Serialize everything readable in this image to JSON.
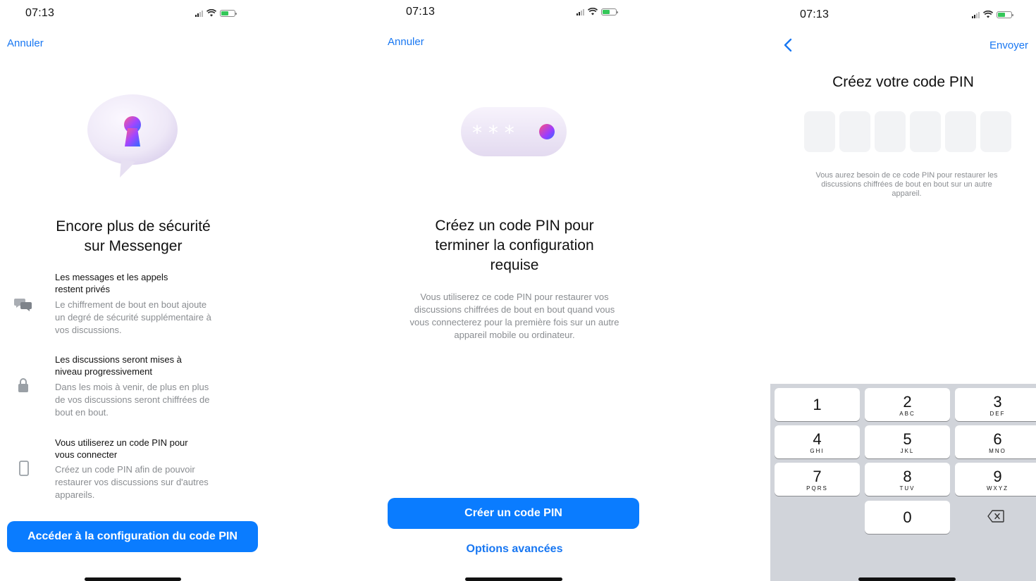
{
  "screen1": {
    "time": "07:13",
    "cancel": "Annuler",
    "icon": "keyhole-bubble-icon",
    "title_line1": "Encore plus de sécurité",
    "title_line2": "sur Messenger",
    "features": [
      {
        "icon": "chat-bubbles-icon",
        "title_line1": "Les messages et les appels",
        "title_line2": "restent privés",
        "desc_line1": "Le chiffrement de bout en bout ajoute",
        "desc_line2": "un degré de sécurité supplémentaire à",
        "desc_line3": "vos discussions."
      },
      {
        "icon": "lock-icon",
        "title_line1": "Les discussions seront mises à",
        "title_line2": "niveau progressivement",
        "desc_line1": "Dans les mois à venir, de plus en plus",
        "desc_line2": "de vos discussions seront chiffrées de",
        "desc_line3": "bout en bout."
      },
      {
        "icon": "phone-icon",
        "title_line1": "Vous utiliserez un code PIN pour",
        "title_line2": "vous connecter",
        "desc_line1": "Créez un code PIN afin de pouvoir",
        "desc_line2": "restaurer vos discussions sur d'autres",
        "desc_line3": "appareils."
      }
    ],
    "button": "Accéder à la configuration du code PIN"
  },
  "screen2": {
    "time": "07:13",
    "cancel": "Annuler",
    "icon": "pin-dots-icon",
    "title_line1": "Créez un code PIN pour",
    "title_line2": "terminer la configuration",
    "title_line3": "requise",
    "desc_line1": "Vous utiliserez ce code PIN pour restaurer vos",
    "desc_line2": "discussions chiffrées de bout en bout quand vous",
    "desc_line3": "vous connecterez pour la première fois sur un autre",
    "desc_line4": "appareil mobile ou ordinateur.",
    "button": "Créer un code PIN",
    "advanced": "Options avancées"
  },
  "screen3": {
    "time": "07:13",
    "back_icon": "chevron-left-icon",
    "send": "Envoyer",
    "title": "Créez votre code PIN",
    "pin_length": 6,
    "desc_line1": "Vous aurez besoin de ce code PIN pour restaurer les",
    "desc_line2": "discussions chiffrées de bout en bout sur un autre",
    "desc_line3": "appareil.",
    "keys": [
      {
        "num": "1",
        "letters": ""
      },
      {
        "num": "2",
        "letters": "ABC"
      },
      {
        "num": "3",
        "letters": "DEF"
      },
      {
        "num": "4",
        "letters": "GHI"
      },
      {
        "num": "5",
        "letters": "JKL"
      },
      {
        "num": "6",
        "letters": "MNO"
      },
      {
        "num": "7",
        "letters": "PQRS"
      },
      {
        "num": "8",
        "letters": "TUV"
      },
      {
        "num": "9",
        "letters": "WXYZ"
      },
      {
        "num": "0",
        "letters": ""
      }
    ],
    "delete_icon": "backspace-icon"
  },
  "colors": {
    "accent": "#0a7cff",
    "link": "#1877f2",
    "secondary_text": "#8a8d91",
    "keypad_bg": "#d1d4da"
  }
}
